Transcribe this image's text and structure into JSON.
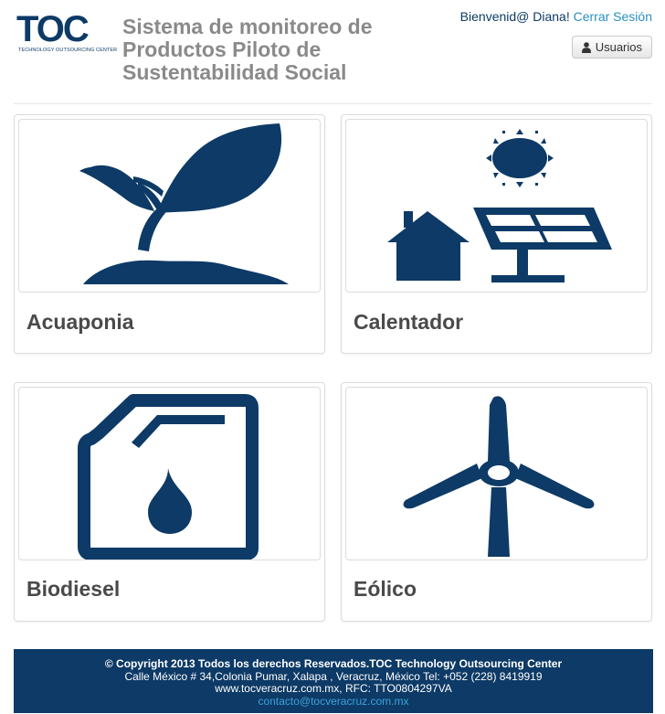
{
  "header": {
    "logo_text": "TOC",
    "logo_subtitle": "TECHNOLOGY OUTSOURCING CENTER",
    "title": "Sistema de monitoreo de Productos Piloto de Sustentabilidad Social",
    "welcome_text": "Bienvenid@ Diana!",
    "logout_label": "Cerrar Sesión",
    "users_button_label": "Usuarios"
  },
  "cards": [
    {
      "label": "Acuaponia",
      "icon": "plant-icon"
    },
    {
      "label": "Calentador",
      "icon": "solar-house-icon"
    },
    {
      "label": "Biodiesel",
      "icon": "fuel-can-icon"
    },
    {
      "label": "Eólico",
      "icon": "wind-turbine-icon"
    }
  ],
  "footer": {
    "copyright": "© Copyright 2013 Todos los derechos Reservados.TOC Technology Outsourcing Center",
    "address": "Calle México # 34,Colonia Pumar, Xalapa , Veracruz, México Tel: +052 (228) 8419919",
    "web_rfc": "www.tocveracruz.com.mx, RFC: TTO0804297VA",
    "email": "contacto@tocveracruz.com.mx"
  },
  "colors": {
    "brand_navy": "#0d3a66",
    "title_gray": "#8a8a8a",
    "link_blue": "#2a8fc0"
  }
}
